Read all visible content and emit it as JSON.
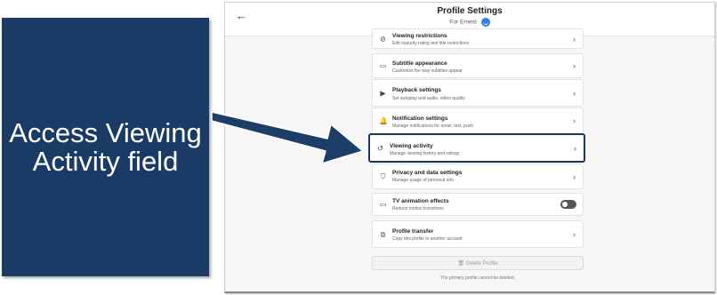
{
  "callout": {
    "text": "Access Viewing Activity field"
  },
  "header": {
    "back_icon": "←",
    "title": "Profile Settings",
    "subtitle": "For Ernest"
  },
  "settings": [
    {
      "id": "viewing-restrictions",
      "title": "Viewing restrictions",
      "desc": "Edit maturity rating and title restrictions",
      "icon": "⊘",
      "control": "chevron"
    },
    {
      "id": "subtitle-appearance",
      "title": "Subtitle appearance",
      "desc": "Customize the way subtitles appear",
      "icon": "▭",
      "control": "chevron"
    },
    {
      "id": "playback-settings",
      "title": "Playback settings",
      "desc": "Set autoplay and audio, video quality",
      "icon": "▶",
      "control": "chevron"
    },
    {
      "id": "notification-settings",
      "title": "Notification settings",
      "desc": "Manage notifications for email, text, push",
      "icon": "🔔",
      "control": "chevron"
    },
    {
      "id": "viewing-activity",
      "title": "Viewing activity",
      "desc": "Manage viewing history and ratings",
      "icon": "↺",
      "control": "chevron",
      "highlighted": true
    },
    {
      "id": "privacy-data",
      "title": "Privacy and data settings",
      "desc": "Manage usage of personal info",
      "icon": "⛉",
      "control": "chevron"
    },
    {
      "id": "tv-animation",
      "title": "TV animation effects",
      "desc": "Reduce motion transitions",
      "icon": "▭",
      "control": "toggle",
      "toggle_on": false
    },
    {
      "id": "profile-transfer",
      "title": "Profile transfer",
      "desc": "Copy this profile to another account",
      "icon": "⧉",
      "control": "chevron"
    }
  ],
  "chevron": "›",
  "delete_button": {
    "icon": "🗑",
    "label": "Delete Profile"
  },
  "footer_note": "The primary profile cannot be deleted.",
  "colors": {
    "callout": "#1a3b66",
    "highlight": "#1c3659",
    "avatar": "#2f7fe0"
  }
}
